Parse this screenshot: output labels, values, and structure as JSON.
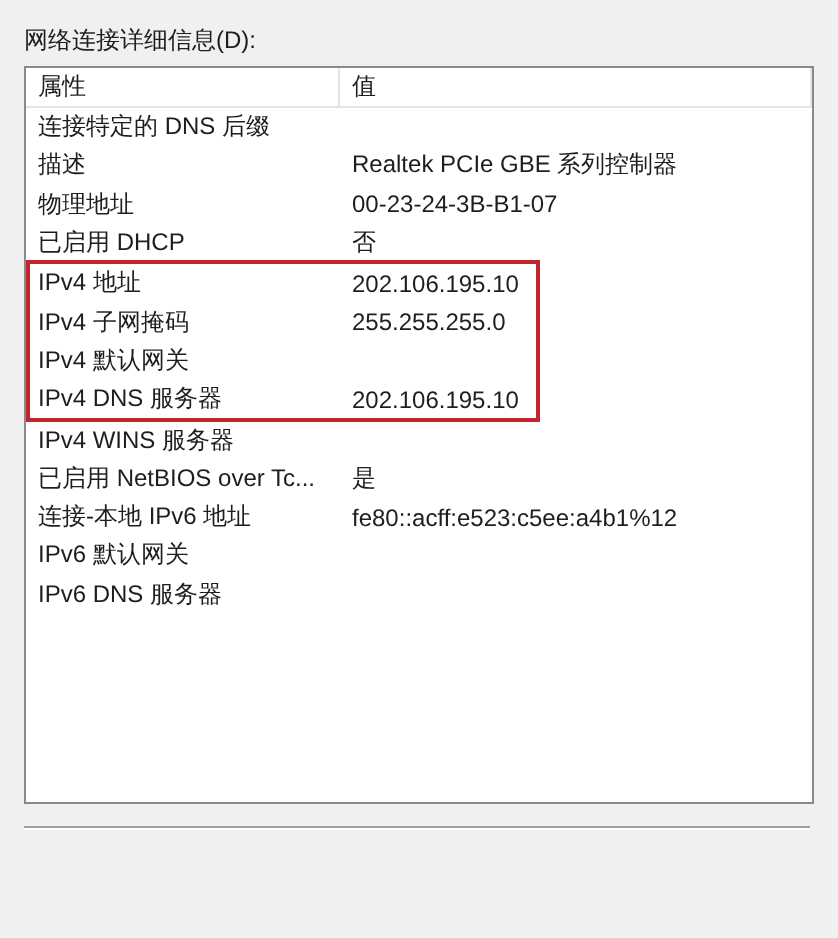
{
  "details_label": "网络连接详细信息(D):",
  "columns": [
    "属性",
    "值"
  ],
  "rows": [
    {
      "property": "连接特定的 DNS 后缀",
      "value": "",
      "highlighted": false
    },
    {
      "property": "描述",
      "value": "Realtek PCIe GBE 系列控制器",
      "highlighted": false
    },
    {
      "property": "物理地址",
      "value": "00-23-24-3B-B1-07",
      "highlighted": false
    },
    {
      "property": "已启用 DHCP",
      "value": "否",
      "highlighted": false
    },
    {
      "property": "IPv4 地址",
      "value": "202.106.195.10",
      "highlighted": true
    },
    {
      "property": "IPv4 子网掩码",
      "value": "255.255.255.0",
      "highlighted": true
    },
    {
      "property": "IPv4 默认网关",
      "value": "",
      "highlighted": true
    },
    {
      "property": "IPv4 DNS 服务器",
      "value": "202.106.195.10",
      "highlighted": true
    },
    {
      "property": "IPv4 WINS 服务器",
      "value": "",
      "highlighted": false
    },
    {
      "property": "已启用 NetBIOS over Tc...",
      "value": "是",
      "highlighted": false
    },
    {
      "property": "连接-本地 IPv6 地址",
      "value": "fe80::acff:e523:c5ee:a4b1%12",
      "highlighted": false
    },
    {
      "property": "IPv6 默认网关",
      "value": "",
      "highlighted": false
    },
    {
      "property": "IPv6 DNS 服务器",
      "value": "",
      "highlighted": false
    }
  ]
}
